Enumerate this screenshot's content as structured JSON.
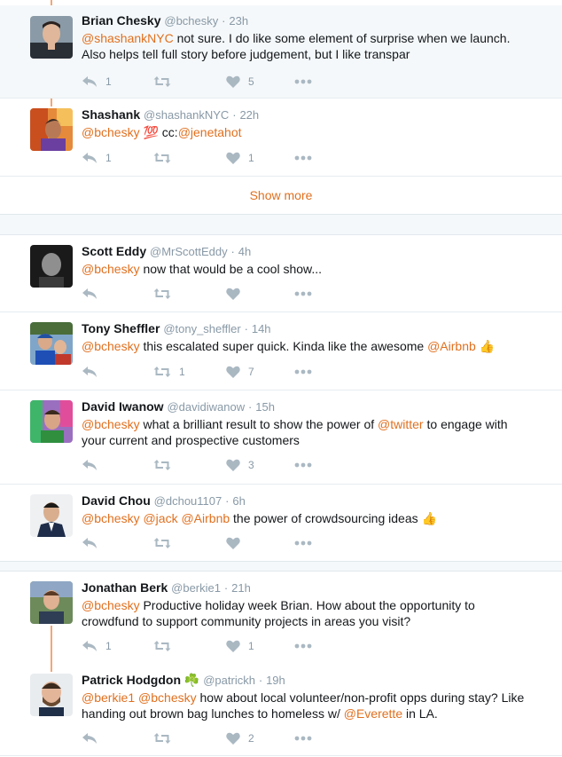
{
  "accent_color": "#e0701f",
  "muted_color": "#8899a6",
  "show_more": "Show more",
  "tweets": [
    {
      "name": "Brian Chesky",
      "handle": "@bchesky",
      "time": "23h",
      "text_parts": [
        {
          "t": "@shashankNYC",
          "mention": true
        },
        {
          "t": " not sure. I do like some element of surprise when we launch. Also helps tell full story before judgement, but I like transpar",
          "mention": false
        }
      ],
      "replies": "1",
      "retweets": "",
      "likes": "5",
      "avatar_icon": "avatar-brian-chesky"
    },
    {
      "name": "Shashank",
      "handle": "@shashankNYC",
      "time": "22h",
      "text_parts": [
        {
          "t": "@bchesky",
          "mention": true
        },
        {
          "t": " 💯 cc:",
          "mention": false
        },
        {
          "t": "@jenetahot",
          "mention": true
        }
      ],
      "replies": "1",
      "retweets": "",
      "likes": "1",
      "avatar_icon": "avatar-shashank"
    },
    {
      "name": "Scott Eddy",
      "handle": "@MrScottEddy",
      "time": "4h",
      "text_parts": [
        {
          "t": "@bchesky",
          "mention": true
        },
        {
          "t": " now that would be a cool show...",
          "mention": false
        }
      ],
      "replies": "",
      "retweets": "",
      "likes": "",
      "avatar_icon": "avatar-scott-eddy"
    },
    {
      "name": "Tony Sheffler",
      "handle": "@tony_sheffler",
      "time": "14h",
      "text_parts": [
        {
          "t": "@bchesky",
          "mention": true
        },
        {
          "t": " this escalated super quick. Kinda like the awesome ",
          "mention": false
        },
        {
          "t": "@Airbnb",
          "mention": true
        },
        {
          "t": " 👍",
          "mention": false
        }
      ],
      "replies": "",
      "retweets": "1",
      "likes": "7",
      "avatar_icon": "avatar-tony-sheffler"
    },
    {
      "name": "David Iwanow",
      "handle": "@davidiwanow",
      "time": "15h",
      "text_parts": [
        {
          "t": "@bchesky",
          "mention": true
        },
        {
          "t": " what a brilliant result to show the power of ",
          "mention": false
        },
        {
          "t": "@twitter",
          "mention": true
        },
        {
          "t": " to engage with your current and prospective customers",
          "mention": false
        }
      ],
      "replies": "",
      "retweets": "",
      "likes": "3",
      "avatar_icon": "avatar-david-iwanow"
    },
    {
      "name": "David Chou",
      "handle": "@dchou1107",
      "time": "6h",
      "text_parts": [
        {
          "t": "@bchesky",
          "mention": true
        },
        {
          "t": " ",
          "mention": false
        },
        {
          "t": "@jack",
          "mention": true
        },
        {
          "t": " ",
          "mention": false
        },
        {
          "t": "@Airbnb",
          "mention": true
        },
        {
          "t": " the power of crowdsourcing ideas 👍",
          "mention": false
        }
      ],
      "replies": "",
      "retweets": "",
      "likes": "",
      "avatar_icon": "avatar-david-chou"
    },
    {
      "name": "Jonathan Berk",
      "handle": "@berkie1",
      "time": "21h",
      "text_parts": [
        {
          "t": "@bchesky",
          "mention": true
        },
        {
          "t": " Productive holiday week Brian.  How about the opportunity to crowdfund to support community projects in areas you visit?",
          "mention": false
        }
      ],
      "replies": "1",
      "retweets": "",
      "likes": "1",
      "avatar_icon": "avatar-jonathan-berk"
    },
    {
      "name": "Patrick Hodgdon ☘️",
      "handle": "@patrickh",
      "time": "19h",
      "text_parts": [
        {
          "t": "@berkie1",
          "mention": true
        },
        {
          "t": " ",
          "mention": false
        },
        {
          "t": "@bchesky",
          "mention": true
        },
        {
          "t": " how about local volunteer/non-profit opps during stay? Like handing out brown bag lunches to homeless w/ ",
          "mention": false
        },
        {
          "t": "@Everette",
          "mention": true
        },
        {
          "t": " in LA.",
          "mention": false
        }
      ],
      "replies": "",
      "retweets": "",
      "likes": "2",
      "avatar_icon": "avatar-patrick-hodgdon"
    }
  ]
}
